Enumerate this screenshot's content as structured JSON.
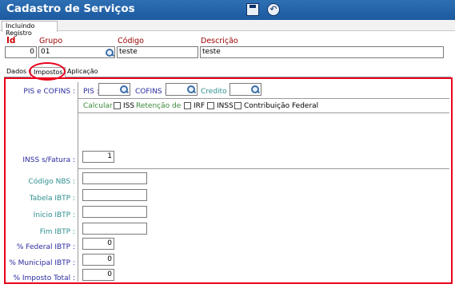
{
  "window": {
    "title": "Cadastro de Serviços"
  },
  "toolbar": {
    "save_icon": "save-icon",
    "back_icon": "back-icon"
  },
  "mode_tab": "Incluindo Registro",
  "header": {
    "id_label": "Id",
    "id_value": "0",
    "grupo_label": "Grupo",
    "grupo_value": "01",
    "codigo_label": "Código",
    "codigo_value": "teste",
    "descricao_label": "Descrição",
    "descricao_value": "teste"
  },
  "tabs": [
    {
      "label": "Dados",
      "active": false
    },
    {
      "label": "Impostos",
      "active": true
    },
    {
      "label": "Aplicação",
      "active": false
    }
  ],
  "impostos": {
    "pis_cofins_label": "PIS e COFINS :",
    "pis_label": "PIS :",
    "pis_value": "",
    "cofins_label": "COFINS :",
    "cofins_value": "",
    "credito_label": "Credito :",
    "credito_value": "",
    "calcular_label": "Calcular :",
    "iss_label": "ISS",
    "iss_checked": false,
    "retencao_label": "Retenção de :",
    "irf_label": "IRF",
    "irf_checked": false,
    "inss_label": "INSS",
    "inss_checked": false,
    "contribuicao_label": "Contribuição Federal",
    "contribuicao_checked": false,
    "inss_fatura_label": "INSS s/Fatura :",
    "inss_fatura_value": "1",
    "codigo_nbs_label": "Código NBS :",
    "codigo_nbs_value": "",
    "tabela_ibtp_label": "Tabela IBTP :",
    "tabela_ibtp_value": "",
    "inicio_ibtp_label": "Inicio IBTP :",
    "inicio_ibtp_value": "",
    "fim_ibtp_label": "Fim IBTP :",
    "fim_ibtp_value": "",
    "federal_ibtp_label": "% Federal IBTP :",
    "federal_ibtp_value": "0",
    "municipal_ibtp_label": "% Municipal IBTP :",
    "municipal_ibtp_value": "0",
    "imposto_total_label": "% Imposto Total :",
    "imposto_total_value": "0"
  },
  "colors": {
    "titlebar": "#1c5aa0",
    "highlight": "#e8001b",
    "label_blue": "#2a2a9f",
    "label_teal": "#2f8f8f",
    "label_green": "#3a8a3a"
  }
}
